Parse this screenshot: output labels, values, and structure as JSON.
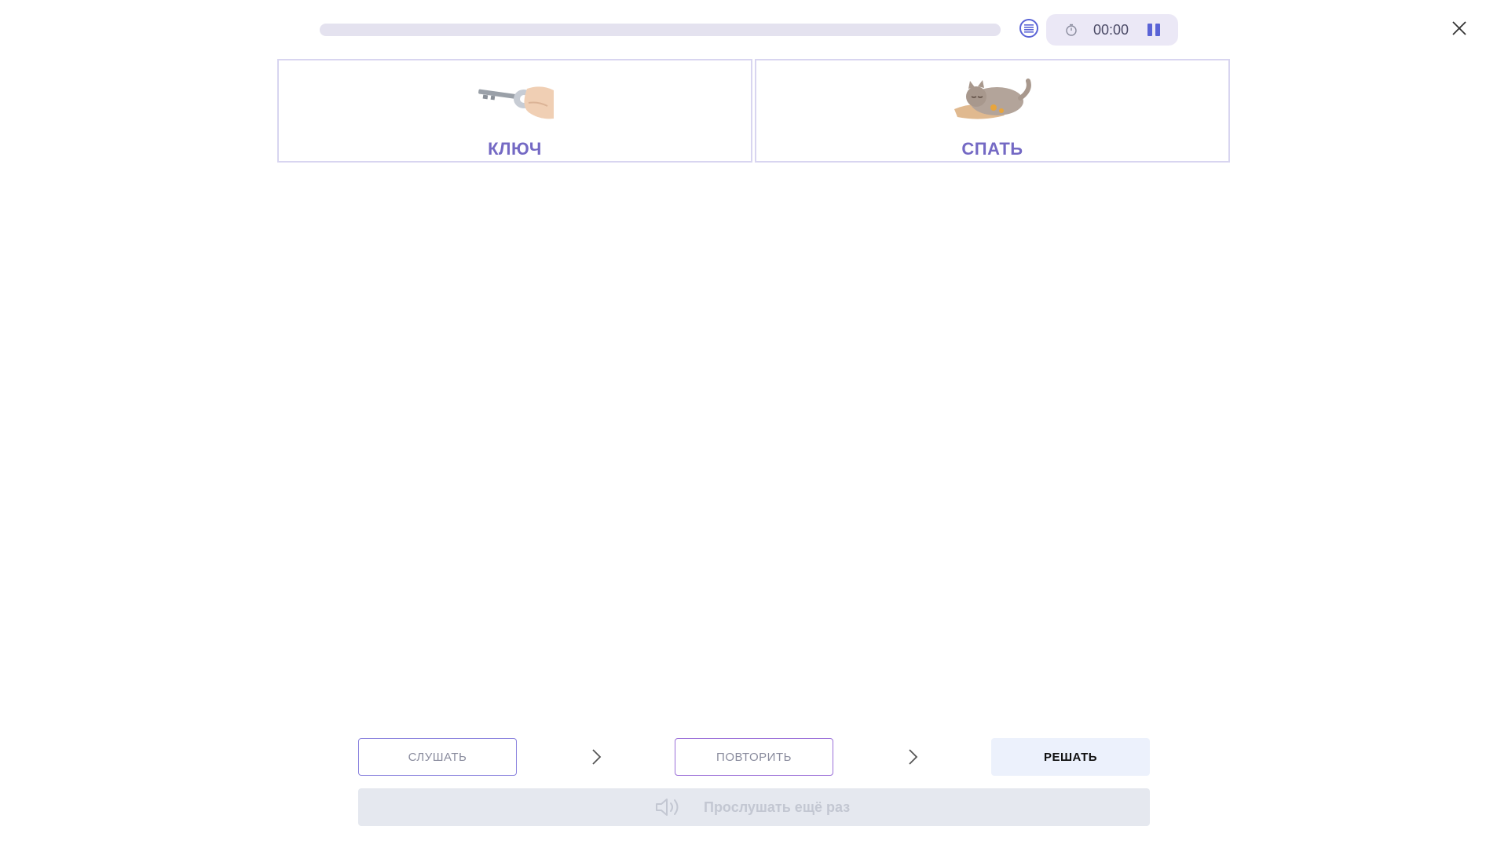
{
  "header": {
    "progress_fraction": 0,
    "timer_text": "00:00"
  },
  "cards": [
    {
      "label": "КЛЮЧ",
      "image": "key-in-hand-image"
    },
    {
      "label": "СПАТЬ",
      "image": "sleeping-cat-image"
    }
  ],
  "steps": {
    "listen_label": "СЛУШАТЬ",
    "repeat_label": "ПОВТОРИТЬ",
    "solve_label": "РЕШАТЬ"
  },
  "replay": {
    "label": "Прослушать ещё раз",
    "icon": "speaker-icon"
  },
  "colors": {
    "accent": "#5a63d6",
    "card_label": "#7469c4",
    "card_border": "#d8d5f0",
    "progress_track": "#e4e2ef",
    "timer_pill": "#ebe8f6",
    "solve_bg": "#ecf1fc",
    "replay_bg": "#e5e8ef"
  }
}
